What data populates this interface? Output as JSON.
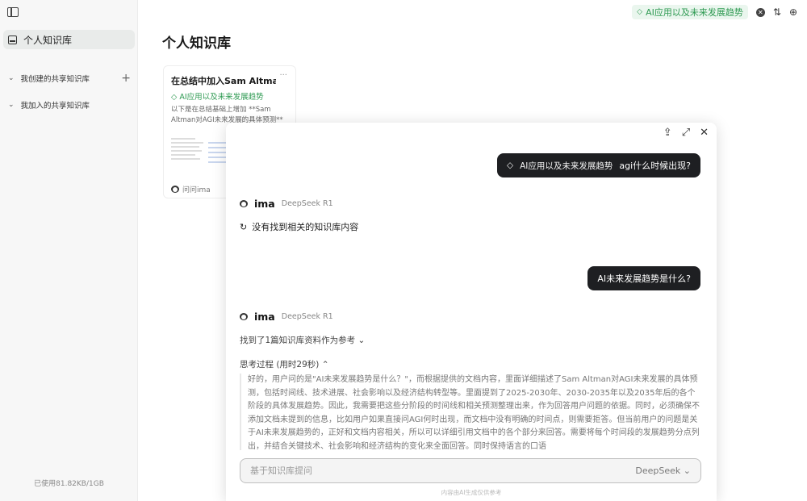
{
  "sidebar": {
    "toggle_icon": "sidebar-toggle-icon",
    "active_item": "个人知识库",
    "groups": [
      {
        "label": "我创建的共享知识库",
        "has_add": true
      },
      {
        "label": "我加入的共享知识库",
        "has_add": false
      }
    ],
    "usage": "已使用81.82KB/1GB"
  },
  "main": {
    "title": "个人知识库",
    "topbar": {
      "tag_label": "AI应用以及未来发展趋势",
      "tag_color": "#2e9a52"
    },
    "doc_card": {
      "title": "在总结中加入Sam Altman…",
      "more": "···",
      "tag": "AI应用以及未来发展趋势",
      "snippet": "以下是在总结基础上增加 **Sam Altman对AGI未来发展的具体预测**",
      "footer": "问问ima"
    }
  },
  "chat": {
    "messages": [
      {
        "role": "user",
        "tag": "AI应用以及未来发展趋势",
        "text": "agi什么时候出现?"
      },
      {
        "role": "bot",
        "name": "ima",
        "model": "DeepSeek R1",
        "status": "没有找到相关的知识库内容"
      },
      {
        "role": "user",
        "text": "AI未来发展趋势是什么?"
      },
      {
        "role": "bot",
        "name": "ima",
        "model": "DeepSeek R1",
        "refs": "找到了1篇知识库资料作为参考 ⌄",
        "thinking_label": "思考过程 (用时29秒) ⌃",
        "thinking": "好的，用户问的是\"AI未来发展趋势是什么？\"，而根据提供的文档内容，里面详细描述了Sam Altman对AGI未来发展的具体预测，包括时间线、技术进展、社会影响以及经济结构转型等。里面提到了2025-2030年、2030-2035年以及2035年后的各个阶段的具体发展趋势。因此，我需要把这些分阶段的时间线和相关预测整理出来，作为回答用户问题的依据。同时，必须确保不添加文档未提到的信息，比如用户如果直接问AGI何时出现，而文档中没有明确的时间点，则需要拒答。但当前用户的问题是关于AI未来发展趋势的，正好和文档内容相关，所以可以详细引用文档中的各个部分来回答。需要将每个时间段的发展趋势分点列出，并结合关键技术、社会影响和经济结构的变化来全面回答。同时保持语言的口语"
      }
    ],
    "input_placeholder": "基于知识库提问",
    "model_select": "DeepSeek ⌄",
    "disclaimer": "内容由AI生成仅供参考"
  }
}
